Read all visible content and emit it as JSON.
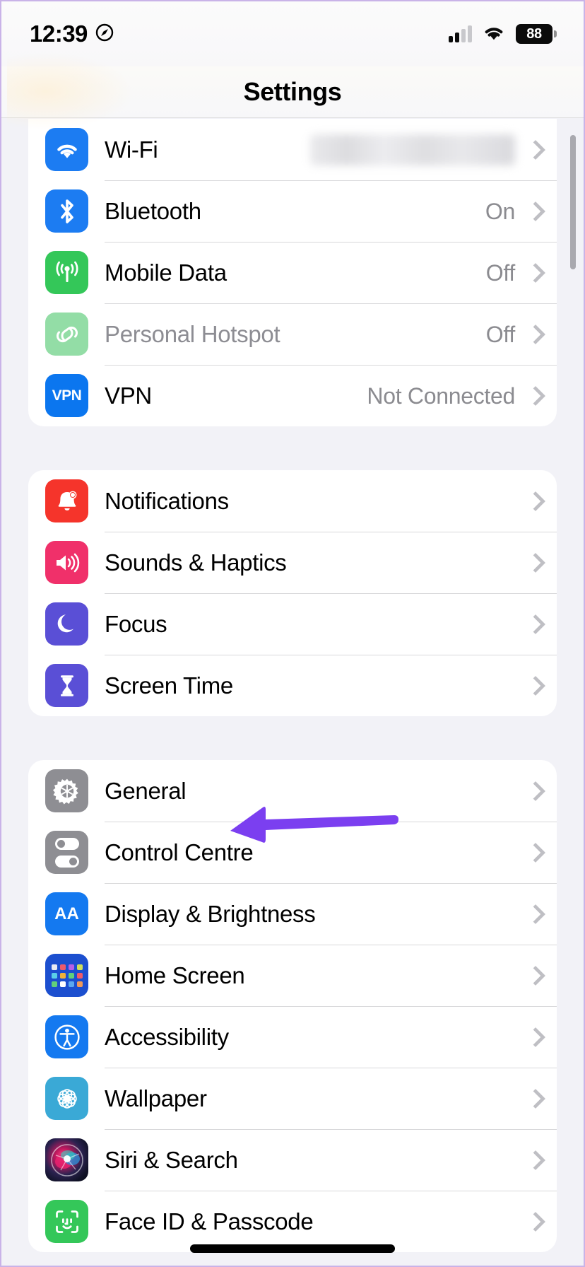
{
  "status_bar": {
    "time": "12:39",
    "location_icon": "location-services-icon",
    "signal_icon": "cellular-signal-icon",
    "wifi_icon": "wifi-status-icon",
    "battery_level": "88"
  },
  "nav": {
    "title": "Settings"
  },
  "annotation": {
    "arrow_color": "#7b3ff0",
    "points_at": "General"
  },
  "groups": [
    {
      "name": "connectivity",
      "rows": [
        {
          "label": "Wi-Fi",
          "value": "",
          "redacted": true,
          "icon": "wifi-icon",
          "icon_class": "ic-wifi",
          "disabled": false
        },
        {
          "label": "Bluetooth",
          "value": "On",
          "redacted": false,
          "icon": "bluetooth-icon",
          "icon_class": "ic-bt",
          "disabled": false
        },
        {
          "label": "Mobile Data",
          "value": "Off",
          "redacted": false,
          "icon": "mobile-data-icon",
          "icon_class": "ic-cell",
          "disabled": false
        },
        {
          "label": "Personal Hotspot",
          "value": "Off",
          "redacted": false,
          "icon": "personal-hotspot-icon",
          "icon_class": "ic-hot",
          "disabled": true
        },
        {
          "label": "VPN",
          "value": "Not Connected",
          "redacted": false,
          "icon": "vpn-icon",
          "icon_class": "ic-vpn",
          "disabled": false
        }
      ]
    },
    {
      "name": "alerts",
      "rows": [
        {
          "label": "Notifications",
          "value": "",
          "redacted": false,
          "icon": "notifications-bell-icon",
          "icon_class": "ic-noti",
          "disabled": false
        },
        {
          "label": "Sounds & Haptics",
          "value": "",
          "redacted": false,
          "icon": "speaker-icon",
          "icon_class": "ic-snd",
          "disabled": false
        },
        {
          "label": "Focus",
          "value": "",
          "redacted": false,
          "icon": "moon-icon",
          "icon_class": "ic-foc",
          "disabled": false
        },
        {
          "label": "Screen Time",
          "value": "",
          "redacted": false,
          "icon": "hourglass-icon",
          "icon_class": "ic-scr",
          "disabled": false
        }
      ]
    },
    {
      "name": "system",
      "rows": [
        {
          "label": "General",
          "value": "",
          "redacted": false,
          "icon": "gear-icon",
          "icon_class": "ic-gen",
          "disabled": false
        },
        {
          "label": "Control Centre",
          "value": "",
          "redacted": false,
          "icon": "control-centre-icon",
          "icon_class": "ic-ctrl",
          "disabled": false
        },
        {
          "label": "Display & Brightness",
          "value": "",
          "redacted": false,
          "icon": "display-brightness-icon",
          "icon_class": "ic-disp",
          "disabled": false
        },
        {
          "label": "Home Screen",
          "value": "",
          "redacted": false,
          "icon": "home-screen-icon",
          "icon_class": "ic-home",
          "disabled": false
        },
        {
          "label": "Accessibility",
          "value": "",
          "redacted": false,
          "icon": "accessibility-icon",
          "icon_class": "ic-acc",
          "disabled": false
        },
        {
          "label": "Wallpaper",
          "value": "",
          "redacted": false,
          "icon": "wallpaper-flower-icon",
          "icon_class": "ic-wall",
          "disabled": false
        },
        {
          "label": "Siri & Search",
          "value": "",
          "redacted": false,
          "icon": "siri-orb-icon",
          "icon_class": "ic-siri",
          "disabled": false
        },
        {
          "label": "Face ID & Passcode",
          "value": "",
          "redacted": false,
          "icon": "face-id-icon",
          "icon_class": "ic-face",
          "disabled": false
        }
      ]
    }
  ]
}
